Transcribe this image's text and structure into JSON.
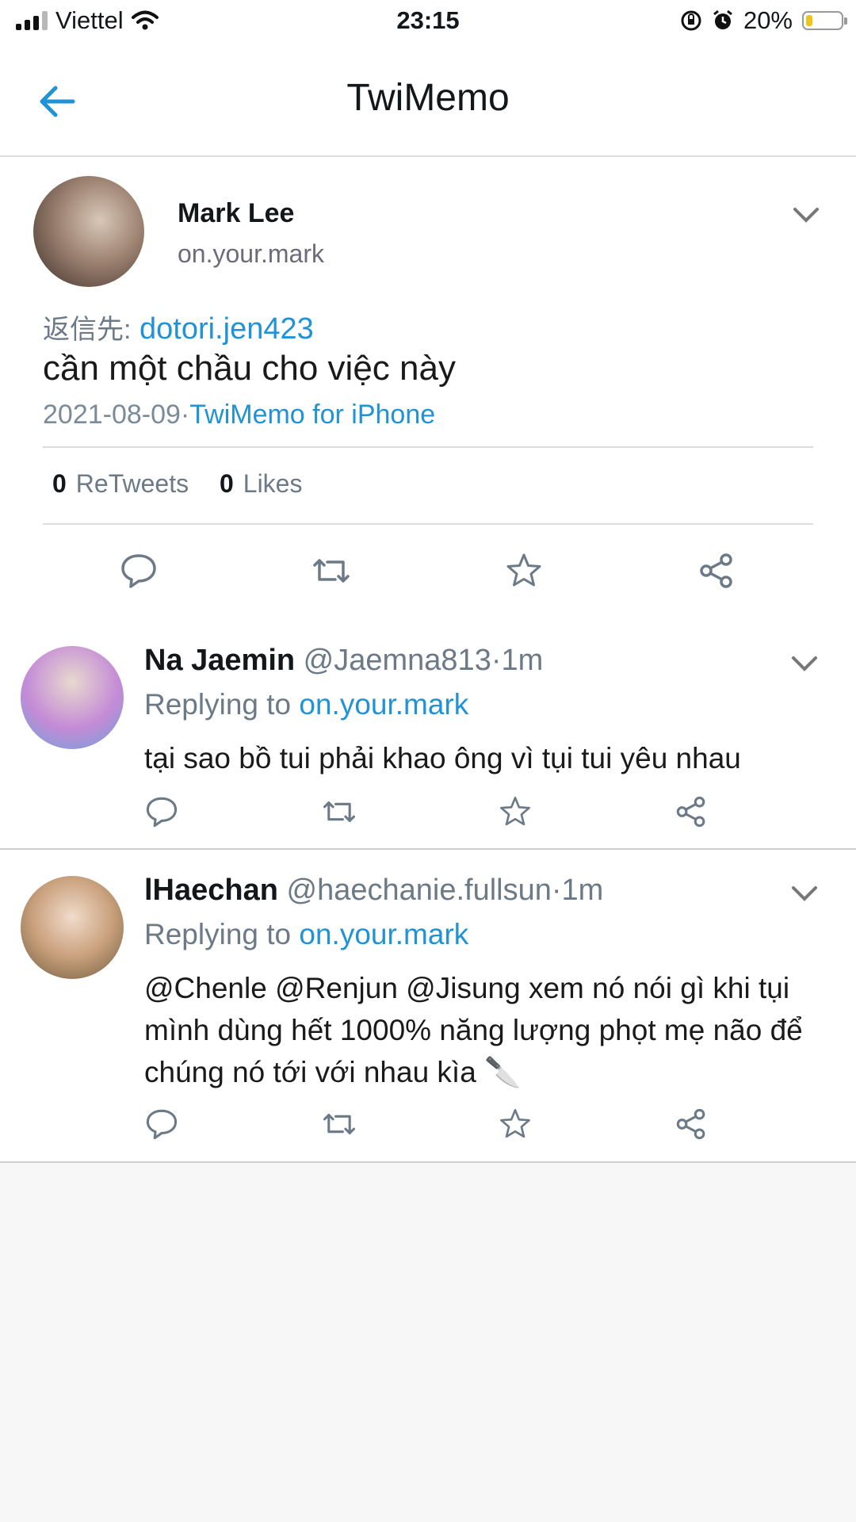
{
  "status": {
    "carrier": "Viettel",
    "time": "23:15",
    "battery": "20%",
    "battery_level": 0.2
  },
  "nav": {
    "title": "TwiMemo"
  },
  "tweet": {
    "name": "Mark Lee",
    "handle": "on.your.mark",
    "reply_prefix": "返信先:",
    "reply_to": "dotori.jen423",
    "text": "cần một chầu cho việc này",
    "date": "2021-08-09",
    "separator": "·",
    "source": "TwiMemo for iPhone",
    "retweets_count": "0",
    "retweets_label": "ReTweets",
    "likes_count": "0",
    "likes_label": "Likes"
  },
  "replies": [
    {
      "name": "Na Jaemin",
      "handle": "@Jaemna813",
      "time": "·1m",
      "replying_label": "Replying to",
      "replying_to": "on.your.mark",
      "text": "tại sao bồ tui phải khao ông vì tụi tui yêu nhau"
    },
    {
      "name": "lHaechan",
      "handle": "@haechanie.fullsun",
      "time": "·1m",
      "replying_label": "Replying to",
      "replying_to": "on.your.mark",
      "text": "@Chenle @Renjun @Jisung xem nó nói gì khi tụi mình dùng hết 1000% năng lượng phọt mẹ não để chúng nó tới với nhau kìa 🔪"
    }
  ],
  "icons": [
    "signal-icon",
    "wifi-icon",
    "rotation-lock-icon",
    "alarm-icon",
    "battery-icon",
    "back-arrow-icon",
    "chevron-down-icon",
    "reply-icon",
    "retweet-icon",
    "star-icon",
    "share-icon"
  ],
  "colors": {
    "accent": "#1f93d6",
    "battery_fill": "#f0c419",
    "secondary_text": "#6b7a86"
  }
}
